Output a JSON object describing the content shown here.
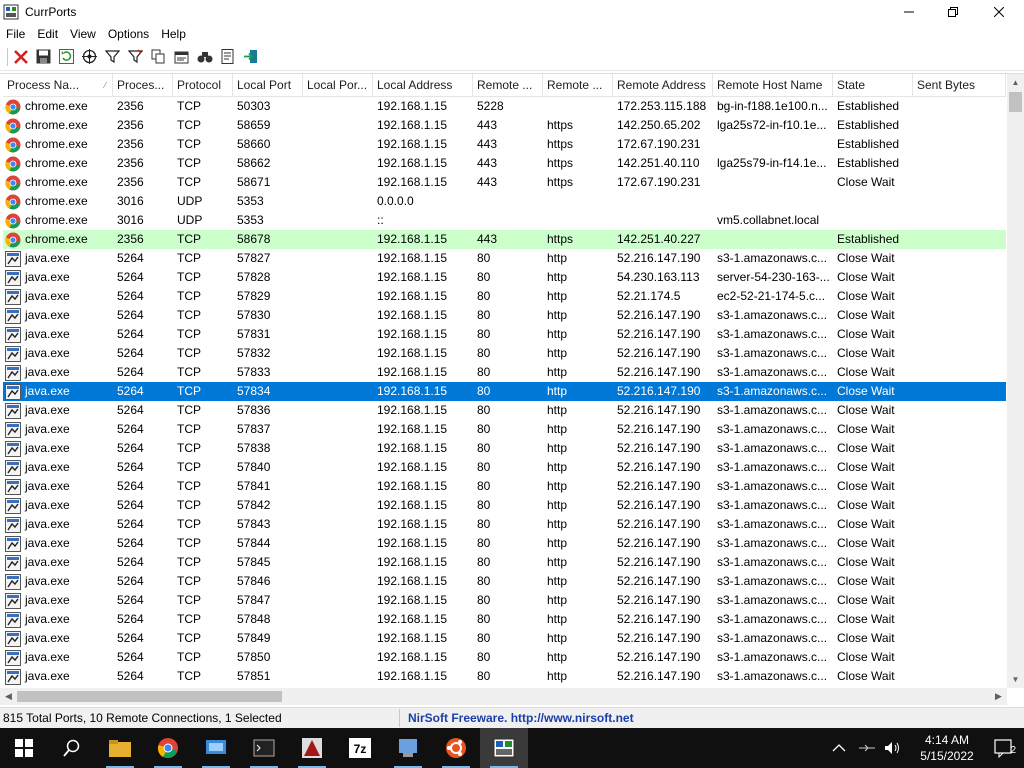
{
  "window": {
    "title": "CurrPorts"
  },
  "menu": [
    "File",
    "Edit",
    "View",
    "Options",
    "Help"
  ],
  "toolbar": {
    "buttons": [
      "close-connections-icon",
      "save-icon",
      "refresh-icon",
      "target-icon",
      "filter-icon",
      "advanced-filter-icon",
      "copy-icon",
      "properties-icon",
      "find-icon",
      "html-report-icon",
      "exit-icon"
    ]
  },
  "columns": [
    "Process Na...",
    "Proces...",
    "Protocol",
    "Local Port",
    "Local Por...",
    "Local Address",
    "Remote ...",
    "Remote ...",
    "Remote Address",
    "Remote Host Name",
    "State",
    "Sent Bytes"
  ],
  "sort": {
    "column": "Process Na...",
    "direction": "ascending"
  },
  "rows": [
    {
      "icon": "chrome",
      "cells": [
        "chrome.exe",
        "2356",
        "TCP",
        "50303",
        "",
        "192.168.1.15",
        "5228",
        "",
        "172.253.115.188",
        "bg-in-f188.1e100.n...",
        "Established",
        ""
      ]
    },
    {
      "icon": "chrome",
      "cells": [
        "chrome.exe",
        "2356",
        "TCP",
        "58659",
        "",
        "192.168.1.15",
        "443",
        "https",
        "142.250.65.202",
        "lga25s72-in-f10.1e...",
        "Established",
        ""
      ]
    },
    {
      "icon": "chrome",
      "cells": [
        "chrome.exe",
        "2356",
        "TCP",
        "58660",
        "",
        "192.168.1.15",
        "443",
        "https",
        "172.67.190.231",
        "",
        "Established",
        ""
      ]
    },
    {
      "icon": "chrome",
      "cells": [
        "chrome.exe",
        "2356",
        "TCP",
        "58662",
        "",
        "192.168.1.15",
        "443",
        "https",
        "142.251.40.110",
        "lga25s79-in-f14.1e...",
        "Established",
        ""
      ]
    },
    {
      "icon": "chrome",
      "cells": [
        "chrome.exe",
        "2356",
        "TCP",
        "58671",
        "",
        "192.168.1.15",
        "443",
        "https",
        "172.67.190.231",
        "",
        "Close Wait",
        ""
      ]
    },
    {
      "icon": "chrome",
      "cells": [
        "chrome.exe",
        "3016",
        "UDP",
        "5353",
        "",
        "0.0.0.0",
        "",
        "",
        "",
        "",
        "",
        ""
      ]
    },
    {
      "icon": "chrome",
      "cells": [
        "chrome.exe",
        "3016",
        "UDP",
        "5353",
        "",
        "::",
        "",
        "",
        "",
        "vm5.collabnet.local",
        "",
        ""
      ]
    },
    {
      "icon": "chrome",
      "highlight": "green",
      "cells": [
        "chrome.exe",
        "2356",
        "TCP",
        "58678",
        "",
        "192.168.1.15",
        "443",
        "https",
        "142.251.40.227",
        "",
        "Established",
        ""
      ]
    },
    {
      "icon": "java",
      "cells": [
        "java.exe",
        "5264",
        "TCP",
        "57827",
        "",
        "192.168.1.15",
        "80",
        "http",
        "52.216.147.190",
        "s3-1.amazonaws.c...",
        "Close Wait",
        ""
      ]
    },
    {
      "icon": "java",
      "cells": [
        "java.exe",
        "5264",
        "TCP",
        "57828",
        "",
        "192.168.1.15",
        "80",
        "http",
        "54.230.163.113",
        "server-54-230-163-...",
        "Close Wait",
        ""
      ]
    },
    {
      "icon": "java",
      "cells": [
        "java.exe",
        "5264",
        "TCP",
        "57829",
        "",
        "192.168.1.15",
        "80",
        "http",
        "52.21.174.5",
        "ec2-52-21-174-5.c...",
        "Close Wait",
        ""
      ]
    },
    {
      "icon": "java",
      "cells": [
        "java.exe",
        "5264",
        "TCP",
        "57830",
        "",
        "192.168.1.15",
        "80",
        "http",
        "52.216.147.190",
        "s3-1.amazonaws.c...",
        "Close Wait",
        ""
      ]
    },
    {
      "icon": "java",
      "cells": [
        "java.exe",
        "5264",
        "TCP",
        "57831",
        "",
        "192.168.1.15",
        "80",
        "http",
        "52.216.147.190",
        "s3-1.amazonaws.c...",
        "Close Wait",
        ""
      ]
    },
    {
      "icon": "java",
      "cells": [
        "java.exe",
        "5264",
        "TCP",
        "57832",
        "",
        "192.168.1.15",
        "80",
        "http",
        "52.216.147.190",
        "s3-1.amazonaws.c...",
        "Close Wait",
        ""
      ]
    },
    {
      "icon": "java",
      "cells": [
        "java.exe",
        "5264",
        "TCP",
        "57833",
        "",
        "192.168.1.15",
        "80",
        "http",
        "52.216.147.190",
        "s3-1.amazonaws.c...",
        "Close Wait",
        ""
      ]
    },
    {
      "icon": "java",
      "selected": true,
      "cells": [
        "java.exe",
        "5264",
        "TCP",
        "57834",
        "",
        "192.168.1.15",
        "80",
        "http",
        "52.216.147.190",
        "s3-1.amazonaws.c...",
        "Close Wait",
        ""
      ]
    },
    {
      "icon": "java",
      "cells": [
        "java.exe",
        "5264",
        "TCP",
        "57836",
        "",
        "192.168.1.15",
        "80",
        "http",
        "52.216.147.190",
        "s3-1.amazonaws.c...",
        "Close Wait",
        ""
      ]
    },
    {
      "icon": "java",
      "cells": [
        "java.exe",
        "5264",
        "TCP",
        "57837",
        "",
        "192.168.1.15",
        "80",
        "http",
        "52.216.147.190",
        "s3-1.amazonaws.c...",
        "Close Wait",
        ""
      ]
    },
    {
      "icon": "java",
      "cells": [
        "java.exe",
        "5264",
        "TCP",
        "57838",
        "",
        "192.168.1.15",
        "80",
        "http",
        "52.216.147.190",
        "s3-1.amazonaws.c...",
        "Close Wait",
        ""
      ]
    },
    {
      "icon": "java",
      "cells": [
        "java.exe",
        "5264",
        "TCP",
        "57840",
        "",
        "192.168.1.15",
        "80",
        "http",
        "52.216.147.190",
        "s3-1.amazonaws.c...",
        "Close Wait",
        ""
      ]
    },
    {
      "icon": "java",
      "cells": [
        "java.exe",
        "5264",
        "TCP",
        "57841",
        "",
        "192.168.1.15",
        "80",
        "http",
        "52.216.147.190",
        "s3-1.amazonaws.c...",
        "Close Wait",
        ""
      ]
    },
    {
      "icon": "java",
      "cells": [
        "java.exe",
        "5264",
        "TCP",
        "57842",
        "",
        "192.168.1.15",
        "80",
        "http",
        "52.216.147.190",
        "s3-1.amazonaws.c...",
        "Close Wait",
        ""
      ]
    },
    {
      "icon": "java",
      "cells": [
        "java.exe",
        "5264",
        "TCP",
        "57843",
        "",
        "192.168.1.15",
        "80",
        "http",
        "52.216.147.190",
        "s3-1.amazonaws.c...",
        "Close Wait",
        ""
      ]
    },
    {
      "icon": "java",
      "cells": [
        "java.exe",
        "5264",
        "TCP",
        "57844",
        "",
        "192.168.1.15",
        "80",
        "http",
        "52.216.147.190",
        "s3-1.amazonaws.c...",
        "Close Wait",
        ""
      ]
    },
    {
      "icon": "java",
      "cells": [
        "java.exe",
        "5264",
        "TCP",
        "57845",
        "",
        "192.168.1.15",
        "80",
        "http",
        "52.216.147.190",
        "s3-1.amazonaws.c...",
        "Close Wait",
        ""
      ]
    },
    {
      "icon": "java",
      "cells": [
        "java.exe",
        "5264",
        "TCP",
        "57846",
        "",
        "192.168.1.15",
        "80",
        "http",
        "52.216.147.190",
        "s3-1.amazonaws.c...",
        "Close Wait",
        ""
      ]
    },
    {
      "icon": "java",
      "cells": [
        "java.exe",
        "5264",
        "TCP",
        "57847",
        "",
        "192.168.1.15",
        "80",
        "http",
        "52.216.147.190",
        "s3-1.amazonaws.c...",
        "Close Wait",
        ""
      ]
    },
    {
      "icon": "java",
      "cells": [
        "java.exe",
        "5264",
        "TCP",
        "57848",
        "",
        "192.168.1.15",
        "80",
        "http",
        "52.216.147.190",
        "s3-1.amazonaws.c...",
        "Close Wait",
        ""
      ]
    },
    {
      "icon": "java",
      "cells": [
        "java.exe",
        "5264",
        "TCP",
        "57849",
        "",
        "192.168.1.15",
        "80",
        "http",
        "52.216.147.190",
        "s3-1.amazonaws.c...",
        "Close Wait",
        ""
      ]
    },
    {
      "icon": "java",
      "cells": [
        "java.exe",
        "5264",
        "TCP",
        "57850",
        "",
        "192.168.1.15",
        "80",
        "http",
        "52.216.147.190",
        "s3-1.amazonaws.c...",
        "Close Wait",
        ""
      ]
    },
    {
      "icon": "java",
      "cells": [
        "java.exe",
        "5264",
        "TCP",
        "57851",
        "",
        "192.168.1.15",
        "80",
        "http",
        "52.216.147.190",
        "s3-1.amazonaws.c...",
        "Close Wait",
        ""
      ]
    }
  ],
  "colors": {
    "selected_row": "#0078d7",
    "highlight_row": "#ccffcc",
    "nirsoft_link": "#1a3fa8"
  },
  "status": {
    "summary": "815 Total Ports, 10 Remote Connections, 1 Selected",
    "link": "NirSoft Freeware.  http://www.nirsoft.net"
  },
  "taskbar": {
    "apps": [
      "file-explorer-icon",
      "chrome-icon",
      "network-app-icon",
      "command-prompt-icon",
      "app-icon",
      "7zip-icon",
      "network-adapter-icon",
      "ubuntu-icon",
      "currports-icon"
    ],
    "clock": {
      "time": "4:14 AM",
      "date": "5/15/2022"
    },
    "notifications": "2"
  }
}
